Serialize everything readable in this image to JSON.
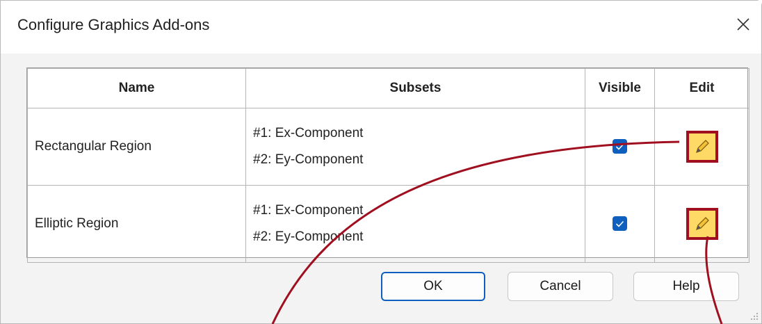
{
  "window": {
    "title": "Configure Graphics Add-ons"
  },
  "table": {
    "headers": {
      "name": "Name",
      "subsets": "Subsets",
      "visible": "Visible",
      "edit": "Edit"
    },
    "rows": [
      {
        "name": "Rectangular Region",
        "subsets": [
          "#1: Ex-Component",
          "#2: Ey-Component"
        ],
        "visible": true
      },
      {
        "name": "Elliptic Region",
        "subsets": [
          "#1: Ex-Component",
          "#2: Ey-Component"
        ],
        "visible": true
      }
    ]
  },
  "buttons": {
    "ok": "OK",
    "cancel": "Cancel",
    "help": "Help"
  },
  "colors": {
    "accent": "#0f5fbf",
    "highlight_border": "#a00f1f",
    "highlight_fill": "#ffd965",
    "annotation_line": "#a00f1f"
  }
}
